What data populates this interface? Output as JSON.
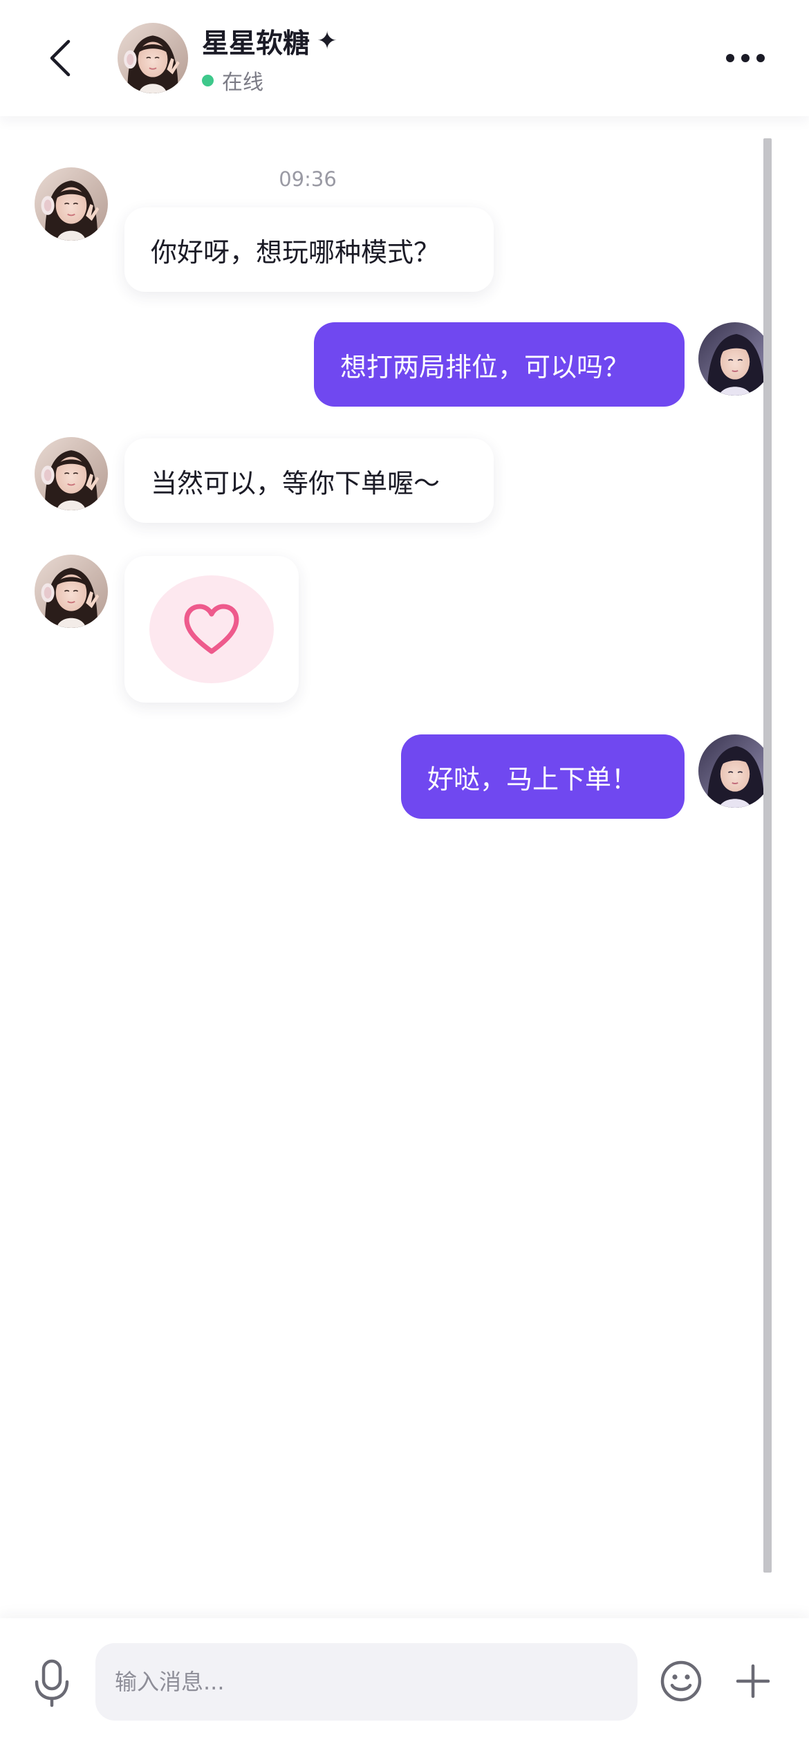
{
  "header": {
    "contact_name": "星星软糖",
    "badge_icon": "sparkle-icon",
    "status_text": "在线",
    "status_color": "#3ec88b",
    "back_icon": "chevron-left-icon",
    "more_icon": "more-dots-icon"
  },
  "chat": {
    "timestamp": "09:36",
    "messages": [
      {
        "direction": "incoming",
        "type": "text",
        "text": "你好呀，想玩哪种模式？"
      },
      {
        "direction": "outgoing",
        "type": "text",
        "text": "想打两局排位，可以吗？"
      },
      {
        "direction": "incoming",
        "type": "text",
        "text": "当然可以，等你下单喔～"
      },
      {
        "direction": "incoming",
        "type": "sticker",
        "icon": "heart-icon"
      },
      {
        "direction": "outgoing",
        "type": "text",
        "text": "好哒，马上下单！"
      }
    ]
  },
  "input_bar": {
    "placeholder": "输入消息...",
    "value": "",
    "mic_icon": "microphone-icon",
    "emoji_icon": "emoji-icon",
    "plus_icon": "plus-icon"
  },
  "colors": {
    "accent": "#7048f0",
    "heart": "#ee5a8c",
    "heart_bg": "#fde8ef",
    "incoming_bubble": "#ffffff",
    "page_bg": "#ffffff"
  }
}
